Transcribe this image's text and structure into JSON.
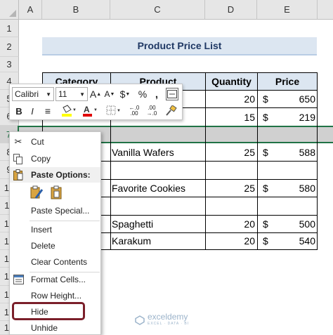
{
  "columns": [
    "A",
    "B",
    "C",
    "D",
    "E"
  ],
  "rows": [
    "1",
    "2",
    "3",
    "4",
    "5",
    "6",
    "7",
    "8",
    "9",
    "10",
    "11",
    "12",
    "13",
    "14",
    "15",
    "16",
    "17",
    "18"
  ],
  "title": "Product Price List",
  "headers": {
    "category": "Category",
    "product": "Product",
    "quantity": "Quantity",
    "price": "Price"
  },
  "table": [
    {
      "qty": "20",
      "cur": "$",
      "price": "650"
    },
    {
      "qty": "15",
      "cur": "$",
      "price": "219"
    },
    {
      "product": "Vanilla Wafers",
      "qty": "25",
      "cur": "$",
      "price": "588"
    },
    {
      "product": "Favorite Cookies",
      "qty": "25",
      "cur": "$",
      "price": "580"
    },
    {
      "product": "Spaghetti",
      "qty": "20",
      "cur": "$",
      "price": "500"
    },
    {
      "product": "Karakum",
      "qty": "20",
      "cur": "$",
      "price": "540"
    }
  ],
  "mini_toolbar": {
    "font": "Calibri",
    "size": "11",
    "bold": "B",
    "italic": "I",
    "currency": "$",
    "percent": "%",
    "comma": ",",
    "inc_dec": "←.0 .00",
    "dec_dec": ".00 →.0"
  },
  "menu": {
    "cut": "Cut",
    "copy": "Copy",
    "paste_options": "Paste Options:",
    "paste_special": "Paste Special...",
    "insert": "Insert",
    "delete": "Delete",
    "clear_contents": "Clear Contents",
    "format_cells": "Format Cells...",
    "row_height": "Row Height...",
    "hide": "Hide",
    "unhide": "Unhide"
  },
  "watermark": "exceldemy",
  "watermark_sub": "EXCEL · DATA · BI",
  "colors": {
    "accent": "#217346",
    "header_fill": "#dce6f1",
    "highlight": "#7b1f2a"
  }
}
